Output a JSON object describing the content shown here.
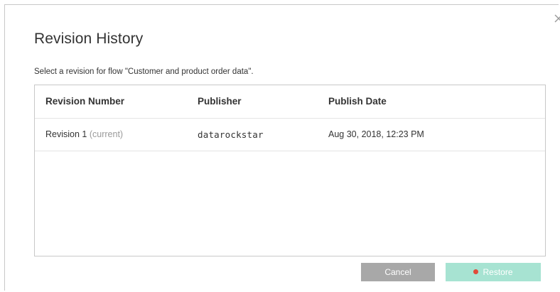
{
  "dialog": {
    "title": "Revision History",
    "subtitle": "Select a revision for flow \"Customer and product order data\".",
    "close_icon": "close-icon"
  },
  "table": {
    "columns": [
      "Revision Number",
      "Publisher",
      "Publish Date"
    ],
    "rows": [
      {
        "revision": "Revision 1",
        "current_tag": "(current)",
        "publisher": "datarockstar",
        "publish_date": "Aug 30, 2018, 12:23 PM"
      }
    ]
  },
  "buttons": {
    "cancel_label": "Cancel",
    "restore_label": "Restore",
    "restore_icon": "restore-icon"
  },
  "colors": {
    "cancel_bg": "#a8a8a8",
    "restore_bg": "#a7e3d2",
    "border": "#c8c8c8",
    "text": "#333333",
    "muted": "#9a9a9a"
  }
}
